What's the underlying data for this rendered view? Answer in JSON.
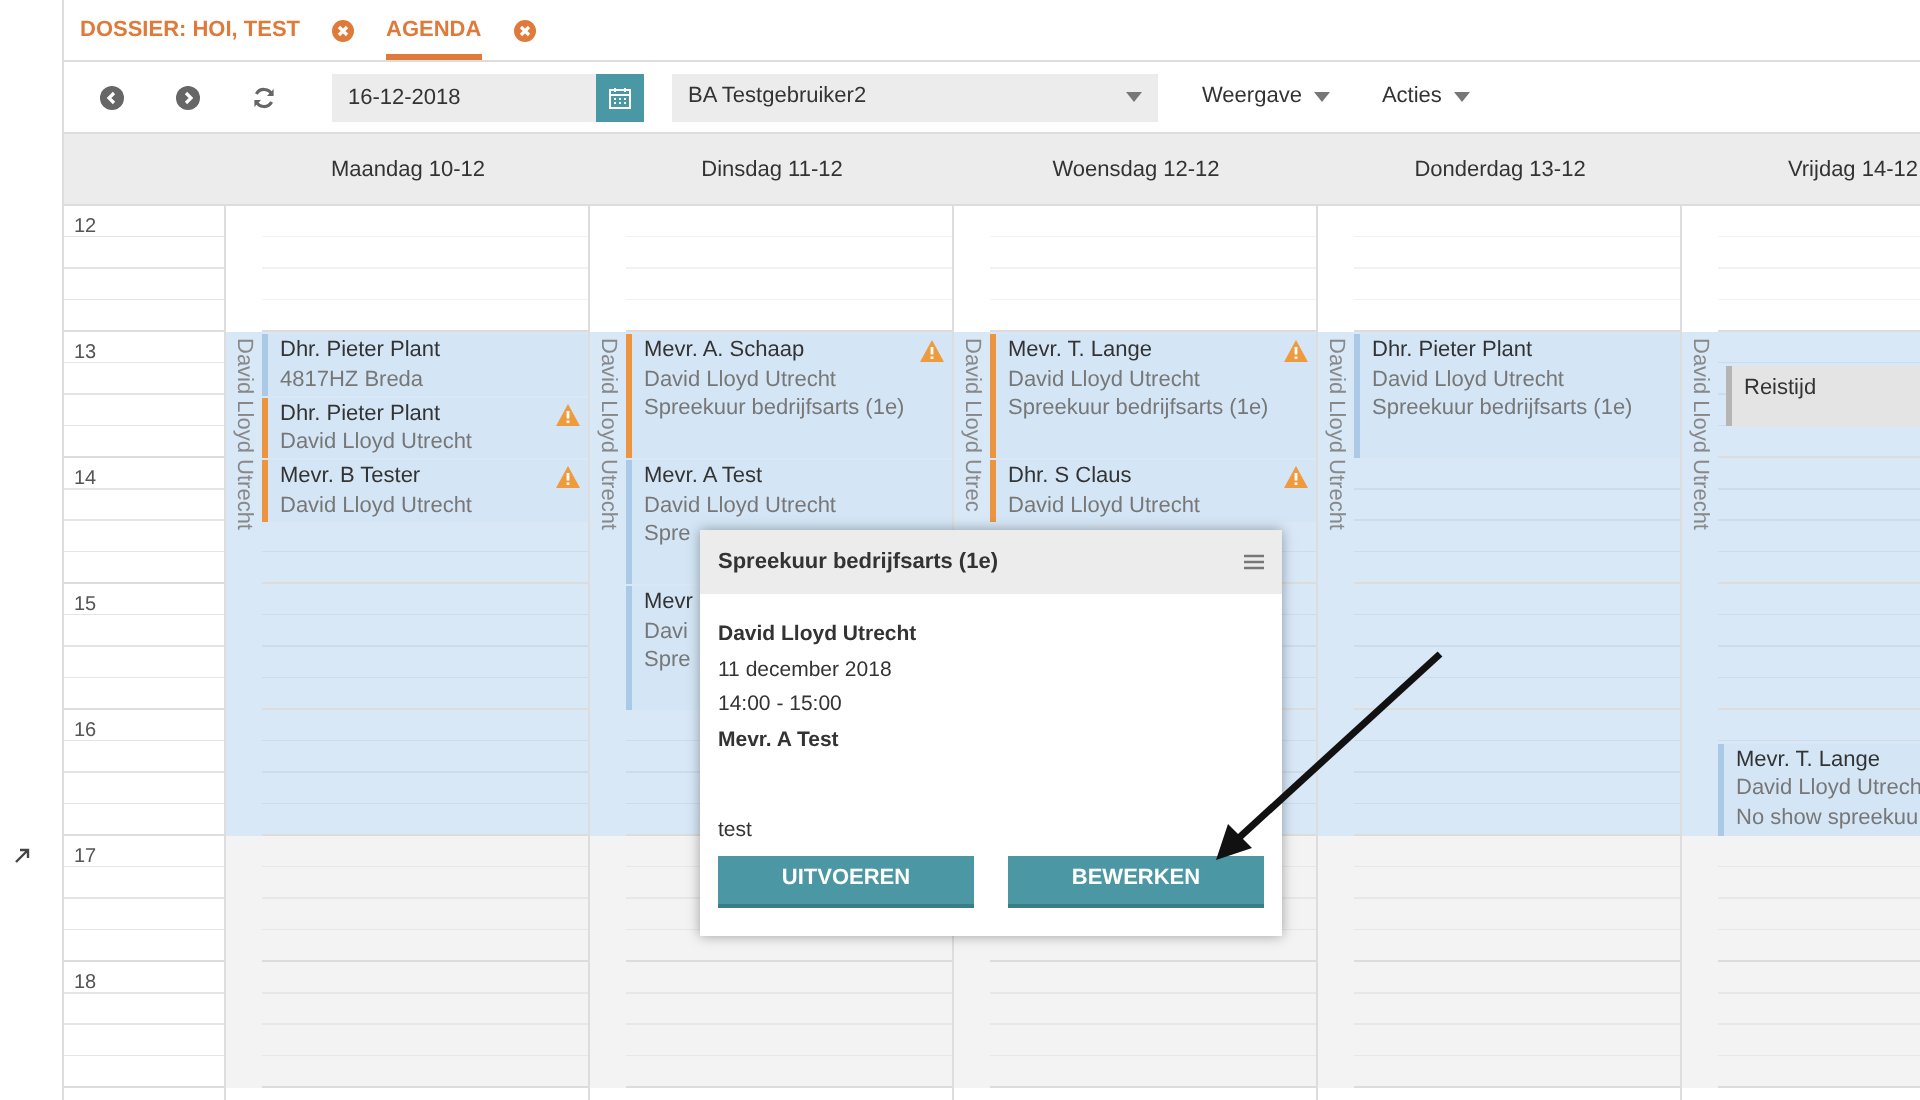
{
  "tabs": [
    {
      "label": "DOSSIER: HOI, TEST",
      "selected": false,
      "closable": true
    },
    {
      "label": "AGENDA",
      "selected": true,
      "closable": true
    }
  ],
  "toolbar": {
    "date": "16-12-2018",
    "user": "BA Testgebruiker2",
    "menus": [
      "Weergave",
      "Acties"
    ]
  },
  "calendar": {
    "hours": [
      "12",
      "13",
      "14",
      "15",
      "16",
      "17",
      "18"
    ],
    "days": [
      {
        "label": "Maandag 10-12",
        "location": "David Lloyd Utrecht",
        "slots": [
          {
            "working": false
          },
          {
            "working": true,
            "events": [
              {
                "kind": "half",
                "color": "#a9c9e6",
                "warning": false,
                "lines": [
                  "Dhr. Pieter Plant",
                  "4817HZ Breda"
                ]
              },
              {
                "kind": "half",
                "color": "#ec9440",
                "warning": true,
                "lines": [
                  "Dhr. Pieter Plant",
                  "David Lloyd Utrecht"
                ]
              }
            ]
          },
          {
            "working": true,
            "events": [
              {
                "kind": "half",
                "color": "#ec9440",
                "warning": true,
                "lines": [
                  "Mevr. B Tester",
                  "David Lloyd Utrecht"
                ]
              }
            ]
          },
          {
            "working": true
          },
          {
            "working": true
          },
          {
            "working": false
          },
          {
            "working": false
          }
        ]
      },
      {
        "label": "Dinsdag 11-12",
        "location": "David Lloyd Utrecht",
        "slots": [
          {
            "working": false
          },
          {
            "working": true,
            "events": [
              {
                "kind": "hour",
                "color": "#ec9440",
                "warning": true,
                "lines": [
                  "Mevr. A. Schaap",
                  "David Lloyd Utrecht",
                  "Spreekuur bedrijfsarts (1e)"
                ]
              }
            ]
          },
          {
            "working": true,
            "events": [
              {
                "kind": "hour",
                "color": "#a9c9e6",
                "warning": false,
                "lines": [
                  "Mevr. A Test",
                  "David Lloyd Utrecht",
                  "Spre"
                ]
              }
            ]
          },
          {
            "working": true,
            "events": [
              {
                "kind": "hour",
                "color": "#a9c9e6",
                "warning": false,
                "lines": [
                  "Mevr",
                  "Davi",
                  "Spre"
                ]
              }
            ]
          },
          {
            "working": true
          },
          {
            "working": false
          },
          {
            "working": false
          }
        ]
      },
      {
        "label": "Woensdag 12-12",
        "location": "David Lloyd Utrec",
        "slots": [
          {
            "working": false
          },
          {
            "working": true,
            "events": [
              {
                "kind": "hour",
                "color": "#ec9440",
                "warning": true,
                "lines": [
                  "Mevr. T. Lange",
                  "David Lloyd Utrecht",
                  "Spreekuur bedrijfsarts (1e)"
                ]
              }
            ]
          },
          {
            "working": true,
            "events": [
              {
                "kind": "half",
                "color": "#ec9440",
                "warning": true,
                "lines": [
                  "Dhr. S Claus",
                  "David Lloyd Utrecht"
                ]
              }
            ]
          },
          {
            "working": true
          },
          {
            "working": true
          },
          {
            "working": false
          },
          {
            "working": false
          }
        ]
      },
      {
        "label": "Donderdag 13-12",
        "location": "David Lloyd Utrecht",
        "slots": [
          {
            "working": false
          },
          {
            "working": true,
            "events": [
              {
                "kind": "hour",
                "color": "#a9c9e6",
                "warning": false,
                "lines": [
                  "Dhr. Pieter Plant",
                  "David Lloyd Utrecht",
                  "Spreekuur bedrijfsarts (1e)"
                ]
              }
            ]
          },
          {
            "working": true
          },
          {
            "working": true
          },
          {
            "working": true
          },
          {
            "working": false
          },
          {
            "working": false
          }
        ]
      },
      {
        "label": "Vrijdag 14-12",
        "location": "David Lloyd Utrecht",
        "slots": [
          {
            "working": false
          },
          {
            "working": true,
            "events": [
              {
                "kind": "travel",
                "color": "#b5b5b5",
                "warning": false,
                "lines": [
                  "Reistijd"
                ]
              }
            ]
          },
          {
            "working": true
          },
          {
            "working": true
          },
          {
            "working": true,
            "events": [
              {
                "kind": "late",
                "color": "#a9c9e6",
                "warning": false,
                "lines": [
                  "Mevr. T. Lange",
                  "David Lloyd Utrech",
                  "No show spreekuu"
                ]
              }
            ]
          },
          {
            "working": false
          },
          {
            "working": false
          }
        ]
      }
    ]
  },
  "popover": {
    "title": "Spreekuur bedrijfsarts (1e)",
    "location": "David Lloyd Utrecht",
    "date": "11 december 2018",
    "time": "14:00 - 15:00",
    "client": "Mevr. A Test",
    "note": "test",
    "buttons": [
      "UITVOEREN",
      "BEWERKEN"
    ]
  }
}
